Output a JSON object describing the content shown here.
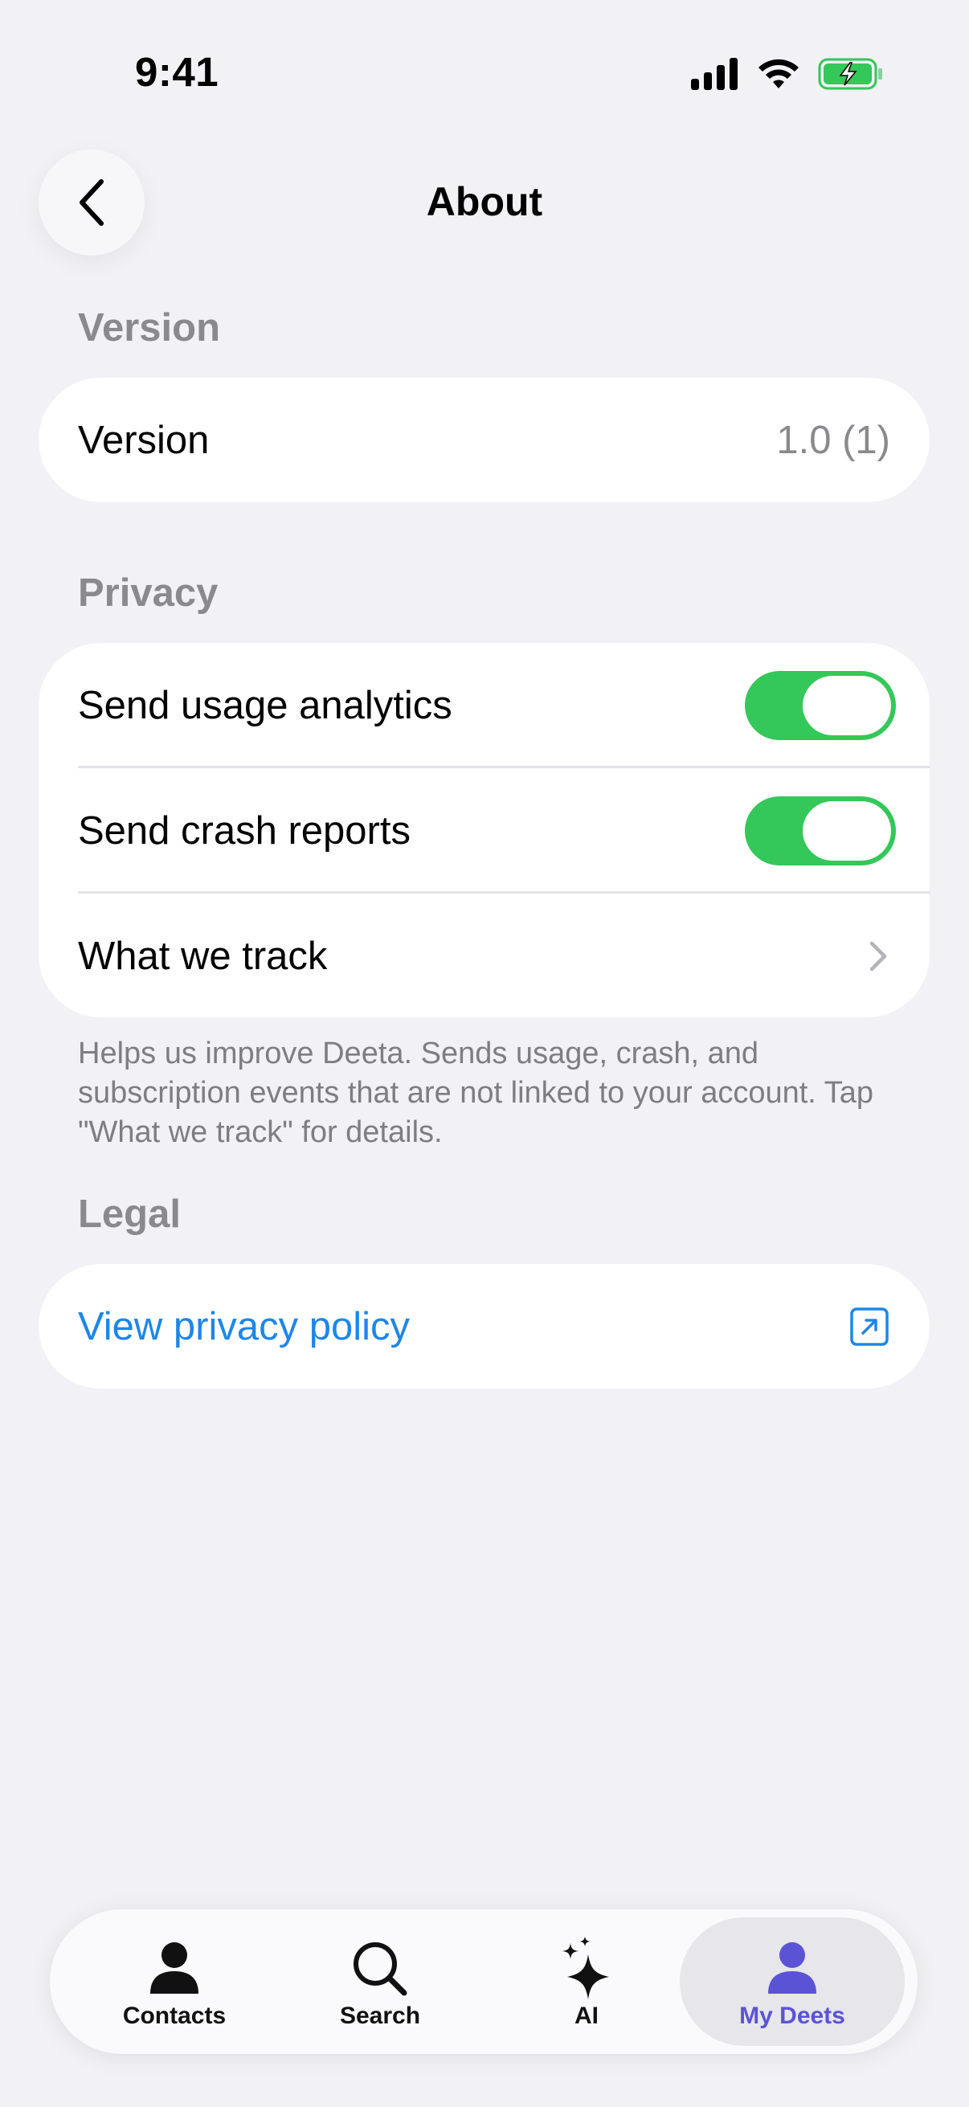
{
  "status_bar": {
    "time": "9:41"
  },
  "header": {
    "title": "About",
    "back_icon": "chevron-left-icon"
  },
  "sections": {
    "version": {
      "header": "Version",
      "rows": [
        {
          "label": "Version",
          "value": "1.0 (1)"
        }
      ]
    },
    "privacy": {
      "header": "Privacy",
      "rows": [
        {
          "label": "Send usage analytics",
          "toggle_on": true
        },
        {
          "label": "Send crash reports",
          "toggle_on": true
        },
        {
          "label": "What we track",
          "icon": "chevron-right-icon"
        }
      ],
      "footnote": "Helps us improve Deeta. Sends usage, crash, and subscription events that are not linked to your account. Tap \"What we track\" for details."
    },
    "legal": {
      "header": "Legal",
      "rows": [
        {
          "label": "View privacy policy",
          "icon": "external-link-icon"
        }
      ]
    }
  },
  "tab_bar": {
    "tabs": [
      {
        "label": "Contacts",
        "icon": "person-icon",
        "active": false
      },
      {
        "label": "Search",
        "icon": "magnifier-icon",
        "active": false
      },
      {
        "label": "AI",
        "icon": "sparkles-icon",
        "active": false
      },
      {
        "label": "My Deets",
        "icon": "person-icon",
        "active": true
      }
    ]
  },
  "colors": {
    "background": "#F1F1F6",
    "toggle_on": "#34C759",
    "link": "#1E86E8",
    "active_tab": "#5B53D6",
    "secondary_text": "#8A8A8E",
    "battery_charging": "#34C759"
  }
}
